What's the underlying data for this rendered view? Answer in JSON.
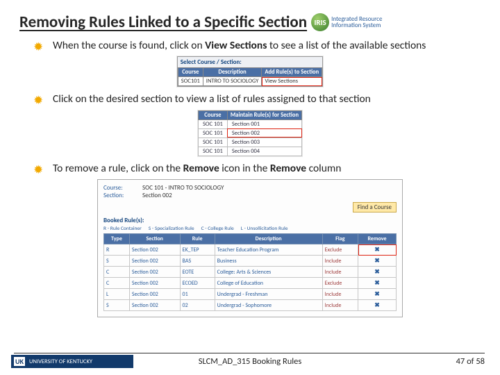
{
  "title": "Removing Rules Linked to a Specific Section",
  "logo": {
    "mark": "IRIS",
    "sub1": "Integrated Resource",
    "sub2": "Information System"
  },
  "bullets": {
    "b1a": "When the course is found, click on ",
    "b1b": "View Sections",
    "b1c": " to see a list of the available sections",
    "b2": "Click on the desired section to view a list of rules assigned to that section",
    "b3a": "To remove a rule, click on the ",
    "b3b": "Remove",
    "b3c": " icon in the ",
    "b3d": "Remove",
    "b3e": " column"
  },
  "fig1": {
    "header": "Select Course / Section:",
    "cols": {
      "c1": "Course",
      "c2": "Description",
      "c3": "Add Rule(s) to Section"
    },
    "row": {
      "course": "SOC101",
      "desc": "INTRO TO SOCIOLOGY",
      "action": "View Sections"
    }
  },
  "fig2": {
    "cols": {
      "c1": "Course",
      "c2": "Maintain Rule(s) for Section"
    },
    "rows": [
      {
        "course": "SOC 101",
        "sec": "Section 001"
      },
      {
        "course": "SOC 101",
        "sec": "Section 002"
      },
      {
        "course": "SOC 101",
        "sec": "Section 003"
      },
      {
        "course": "SOC 101",
        "sec": "Section 004"
      }
    ],
    "hl_index": 1
  },
  "fig3": {
    "fields": {
      "courseLbl": "Course:",
      "courseVal": "SOC 101 - INTRO TO SOCIOLOGY",
      "sectionLbl": "Section:",
      "sectionVal": "Section 002",
      "findBtn": "Find a Course"
    },
    "booked": "Booked Rule(s):",
    "cols": {
      "c1": "Type",
      "c2": "Section",
      "c3": "Rule",
      "c4": "Description",
      "c5": "Flag",
      "c6": "Remove"
    },
    "legend": {
      "r": "R - Rule Container",
      "s": "S - Specialization Rule",
      "c": "C - College Rule",
      "l": "L - Unsollicitation Rule"
    },
    "rows": [
      {
        "t": "R",
        "sec": "Section 002",
        "rule": "EK_TEP",
        "desc": "Teacher Education Program",
        "flag": "Exclude",
        "hl": true
      },
      {
        "t": "S",
        "sec": "Section 002",
        "rule": "BAS",
        "desc": "Business",
        "flag": "Include",
        "hl": false
      },
      {
        "t": "C",
        "sec": "Section 002",
        "rule": "EOTE",
        "desc": "College: Arts & Sciences",
        "flag": "Include",
        "hl": false
      },
      {
        "t": "C",
        "sec": "Section 002",
        "rule": "ECOED",
        "desc": "College of Education",
        "flag": "Exclude",
        "hl": false
      },
      {
        "t": "L",
        "sec": "Section 002",
        "rule": "01",
        "desc": "Undergrad - Freshman",
        "flag": "Include",
        "hl": false
      },
      {
        "t": "S",
        "sec": "Section 002",
        "rule": "02",
        "desc": "Undergrad - Sophomore",
        "flag": "Include",
        "hl": false
      }
    ]
  },
  "footer": {
    "uk_mark": "UK",
    "uk_text": "UNIVERSITY OF KENTUCKY",
    "center": "SLCM_AD_315 Booking Rules",
    "page": "47 of 58"
  }
}
